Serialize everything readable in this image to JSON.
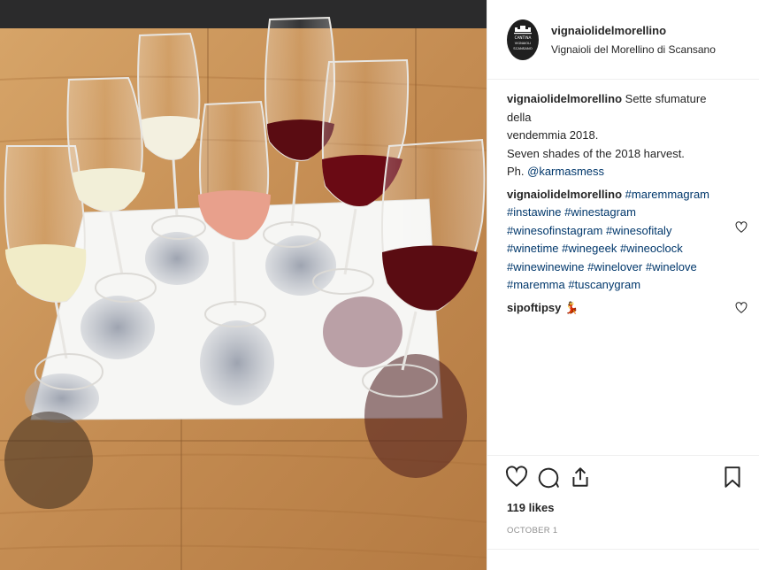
{
  "post": {
    "username": "vignaiolidelmorellino",
    "location": "Vignaioli del Morellino di Scansano",
    "avatar_text": [
      "CANTINA",
      "VIGNAIOLI",
      "SCANSANO"
    ],
    "caption": {
      "username": "vignaiolidelmorellino",
      "line1": "Sette sfumature della",
      "line2": "vendemmia 2018.",
      "line3": "Seven shades of the 2018 harvest.",
      "line4_prefix": "Ph. ",
      "line4_mention": "@karmasmess"
    },
    "hashtags_comment": {
      "username": "vignaiolidelmorellino",
      "lines": [
        [
          "#maremmagram"
        ],
        [
          "#instawine",
          "#winestagram"
        ],
        [
          "#winesofinstagram",
          "#winesofitaly"
        ],
        [
          "#winetime",
          "#winegeek",
          "#wineoclock"
        ],
        [
          "#winewinewine",
          "#winelover",
          "#winelove"
        ],
        [
          "#maremma",
          "#tuscanygram"
        ]
      ]
    },
    "second_comment": {
      "username": "sipoftipsy",
      "emoji": "💃"
    },
    "likes": "119 likes",
    "date": "OCTOBER 1"
  },
  "icons": {
    "like": "heart-icon",
    "comment": "comment-bubble-icon",
    "share": "share-icon",
    "save": "bookmark-icon",
    "comment_like": "small-heart-icon"
  },
  "colors": {
    "text": "#262626",
    "hashtag": "#00376b",
    "muted": "#8e8e8e",
    "divider": "#efefef",
    "table_wood": "#c9955a",
    "white_wine": "#f1ecc8",
    "rose_wine": "#e8a08c",
    "red_wine": "#5a0c12"
  }
}
